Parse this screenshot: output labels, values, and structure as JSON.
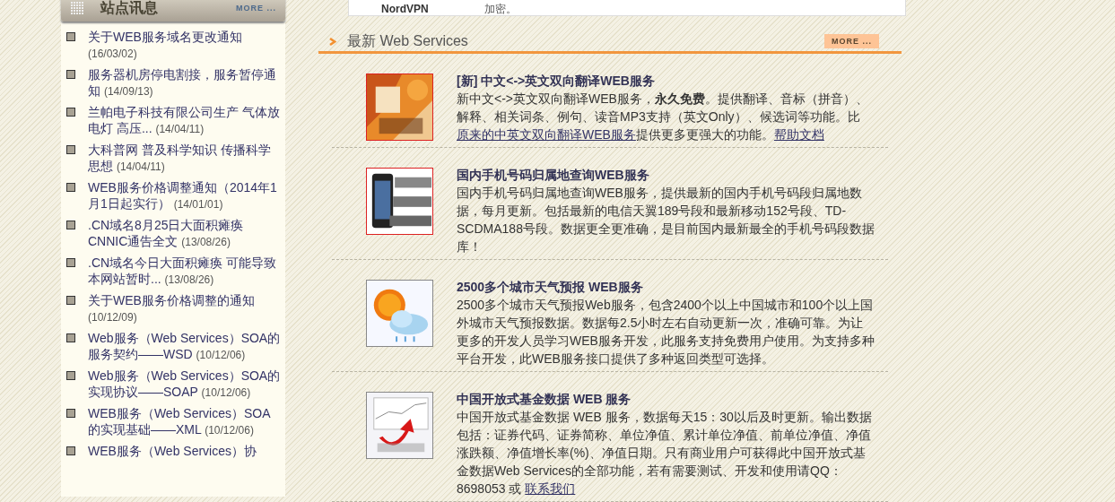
{
  "top_panel": {
    "name": "NordVPN",
    "text": "加密。"
  },
  "sidebar": {
    "title": "站点讯息",
    "more": "MORE ...",
    "items": [
      {
        "title": "关于WEB服务域名更改通知",
        "date": "(16/03/02)"
      },
      {
        "title": "服务器机房停电割接，服务暂停通知",
        "date": "(14/09/13)"
      },
      {
        "title": "兰帕电子科技有限公司生产 气体放电灯 高压...",
        "date": "(14/04/11)"
      },
      {
        "title": "大科普网 普及科学知识 传播科学思想",
        "date": "(14/04/11)"
      },
      {
        "title": "WEB服务价格调整通知（2014年1月1日起实行）",
        "date": "(14/01/01)"
      },
      {
        "title": ".CN域名8月25日大面积瘫痪 CNNIC通告全文",
        "date": "(13/08/26)"
      },
      {
        "title": ".CN域名今日大面积瘫痪 可能导致本网站暂时...",
        "date": "(13/08/26)"
      },
      {
        "title": "关于WEB服务价格调整的通知",
        "date": "(10/12/09)"
      },
      {
        "title": "Web服务（Web Services）SOA的服务契约——WSD",
        "date": "(10/12/06)"
      },
      {
        "title": "Web服务（Web Services）SOA的实现协议——SOAP",
        "date": "(10/12/06)"
      },
      {
        "title": "WEB服务（Web Services）SOA的实现基础——XML",
        "date": "(10/12/06)"
      },
      {
        "title": "WEB服务（Web Services）协"
      }
    ]
  },
  "services": {
    "title": "最新 Web Services",
    "more": "MORE ...",
    "items": [
      {
        "kind": "translate",
        "title": "[新] 中文<->英文双向翻译WEB服务",
        "description": [
          {
            "kind": "text",
            "text": "新中文<->英文双向翻译WEB服务，"
          },
          {
            "kind": "bold",
            "text": "永久免费"
          },
          {
            "kind": "text",
            "text": "。提供翻译、音标（拼音）、解释、相关词条、例句、读音MP3支持（英文Only）、候选词等功能。比"
          },
          {
            "kind": "link",
            "text": "原来的中英文双向翻译WEB服务"
          },
          {
            "kind": "text",
            "text": "提供更多更强大的功能。"
          },
          {
            "kind": "link",
            "text": "帮助文档"
          }
        ]
      },
      {
        "kind": "phone",
        "title": "国内手机号码归属地查询WEB服务",
        "description": [
          {
            "kind": "text",
            "text": "国内手机号码归属地查询WEB服务，提供最新的国内手机号码段归属地数据，每月更新。包括最新的电信天翼189号段和最新移动152号段、TD-SCDMA188号段。数据更全更准确，是目前国内最新最全的手机号码段数据库！"
          }
        ]
      },
      {
        "kind": "weather",
        "title": "2500多个城市天气预报 WEB服务",
        "description": [
          {
            "kind": "text",
            "text": "2500多个城市天气预报Web服务，包含2400个以上中国城市和100个以上国外城市天气预报数据。数据每2.5小时左右自动更新一次，准确可靠。为让更多的开发人员学习WEB服务开发，此服务支持免费用户使用。为支持多种平台开发，此WEB服务接口提供了多种返回类型可选择。"
          }
        ]
      },
      {
        "kind": "fund",
        "title": "中国开放式基金数据 WEB 服务",
        "description": [
          {
            "kind": "text",
            "text": "中国开放式基金数据 WEB 服务，数据每天15：30以后及时更新。输出数据包括：证券代码、证券简称、单位净值、累计单位净值、前单位净值、净值涨跌额、净值增长率(%)、净值日期。只有商业用户可获得此中国开放式基金数据Web Services的全部功能，若有需要测试、开发和使用请QQ：8698053 或 "
          },
          {
            "kind": "link",
            "text": "联系我们"
          }
        ]
      }
    ]
  }
}
